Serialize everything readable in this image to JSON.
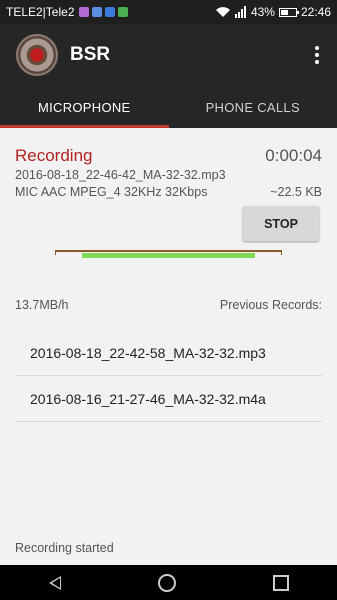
{
  "status_bar": {
    "carrier": "TELE2|Tele2",
    "battery": "43%",
    "time": "22:46",
    "battery_level": 0.43
  },
  "app_bar": {
    "title": "BSR"
  },
  "tabs": [
    {
      "label": "MICROPHONE"
    },
    {
      "label": "PHONE CALLS"
    }
  ],
  "recording": {
    "status": "Recording",
    "timer": "0:00:04",
    "filename": "2016-08-18_22-46-42_MA-32-32.mp3",
    "codec": "MIC AAC MPEG_4 32KHz 32Kbps",
    "size": "~22.5 KB",
    "stop_label": "STOP",
    "level_fraction": 0.76
  },
  "rate": "13.7MB/h",
  "previous_label": "Previous Records:",
  "records": [
    "2016-08-18_22-42-58_MA-32-32.mp3",
    "2016-08-16_21-27-46_MA-32-32.m4a"
  ],
  "log": "Recording started",
  "colors": {
    "accent": "#c0392b",
    "level_bar": "#7ed957",
    "app_bar": "#262626"
  },
  "icons": {
    "back": "back-triangle",
    "home": "home-circle",
    "recent": "recent-square",
    "overflow": "overflow-dots",
    "wifi": "wifi-icon",
    "signal": "signal-icon"
  }
}
